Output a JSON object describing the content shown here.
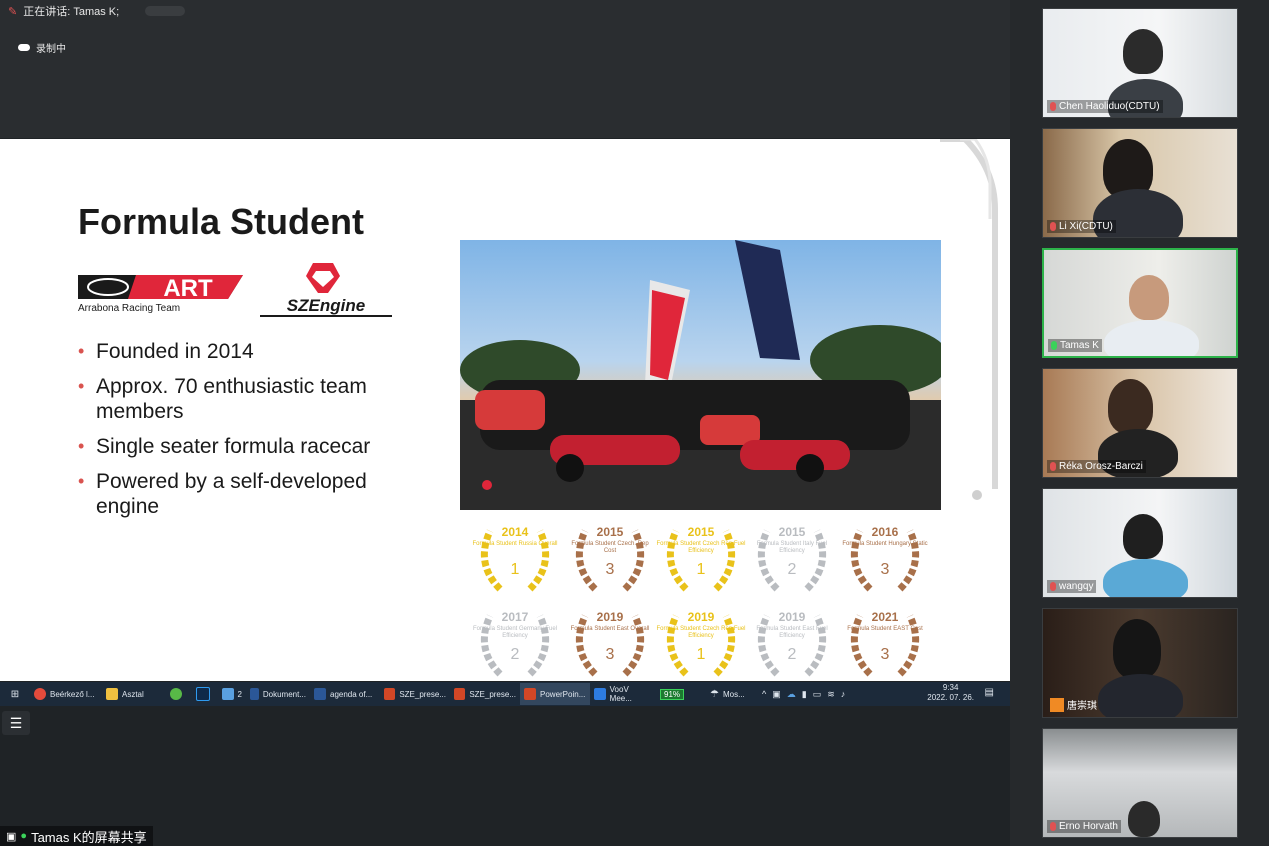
{
  "meeting": {
    "speaking_text": "正在讲话: Tamas K;",
    "recording_text": "录制中",
    "share_label": "Tamas K的屏幕共享"
  },
  "slide": {
    "title": "Formula Student",
    "art_logo_text": "ART",
    "art_logo_subtitle": "Arrabona Racing Team",
    "sze_logo_text": "SZEngine",
    "bullets": [
      "Founded in 2014",
      "Approx. 70 enthusiastic team members",
      "Single seater formula racecar",
      "Powered by a self-developed engine"
    ],
    "awards": [
      {
        "year": "2014",
        "event": "Formula Student Russia Overall",
        "place": "1",
        "color": "#e9c21a"
      },
      {
        "year": "2015",
        "event": "Formula Student Czech. Rep Cost",
        "place": "3",
        "color": "#a8704a"
      },
      {
        "year": "2015",
        "event": "Formula Student Czech Rep Fuel Efficiency",
        "place": "1",
        "color": "#e9c21a"
      },
      {
        "year": "2015",
        "event": "Formula Student Italy Fuel Efficiency",
        "place": "2",
        "color": "#b9bcc0"
      },
      {
        "year": "2016",
        "event": "Formula Student Hungary Static",
        "place": "3",
        "color": "#a8704a"
      },
      {
        "year": "2017",
        "event": "Formula Student Germany Fuel Efficiency",
        "place": "2",
        "color": "#b9bcc0"
      },
      {
        "year": "2019",
        "event": "Formula Student East Overall",
        "place": "3",
        "color": "#a8704a"
      },
      {
        "year": "2019",
        "event": "Formula Student Czech Rep Fuel Efficiency",
        "place": "1",
        "color": "#e9c21a"
      },
      {
        "year": "2019",
        "event": "Formula Student East Fuel Efficiency",
        "place": "2",
        "color": "#b9bcc0"
      },
      {
        "year": "2021",
        "event": "Formula Student EAST Cost",
        "place": "3",
        "color": "#a8704a"
      }
    ]
  },
  "taskbar": {
    "items": [
      {
        "label": "Beérkező l...",
        "color": "#e44b3c"
      },
      {
        "label": "Asztal",
        "color": "#f0c040"
      },
      {
        "label": "",
        "color": "#58b947"
      },
      {
        "label": "",
        "color": "#2f6fb5"
      },
      {
        "label": "2",
        "color": "#5aa0e0"
      },
      {
        "label": "Dokument...",
        "color": "#2b5797"
      },
      {
        "label": "agenda of...",
        "color": "#2b5797"
      },
      {
        "label": "SZE_prese...",
        "color": "#d24726"
      },
      {
        "label": "SZE_prese...",
        "color": "#d24726"
      },
      {
        "label": "PowerPoin...",
        "color": "#d24726"
      },
      {
        "label": "VooV Mee...",
        "color": "#2d7be0"
      }
    ],
    "battery": "91%",
    "weather": "Mos...",
    "time": "9:34",
    "date": "2022. 07. 26."
  },
  "participants": [
    {
      "name": "Chen Haoliduo(CDTU)",
      "muted": true,
      "active": false
    },
    {
      "name": "Li Xi(CDTU)",
      "muted": true,
      "active": false
    },
    {
      "name": "Tamas K",
      "muted": false,
      "active": true
    },
    {
      "name": "Réka Orosz-Barczi",
      "muted": true,
      "active": false
    },
    {
      "name": "wangqy",
      "muted": true,
      "active": false
    },
    {
      "name": "唐崇琪",
      "muted": true,
      "active": false
    },
    {
      "name": "Erno Horvath",
      "muted": true,
      "active": false
    }
  ]
}
